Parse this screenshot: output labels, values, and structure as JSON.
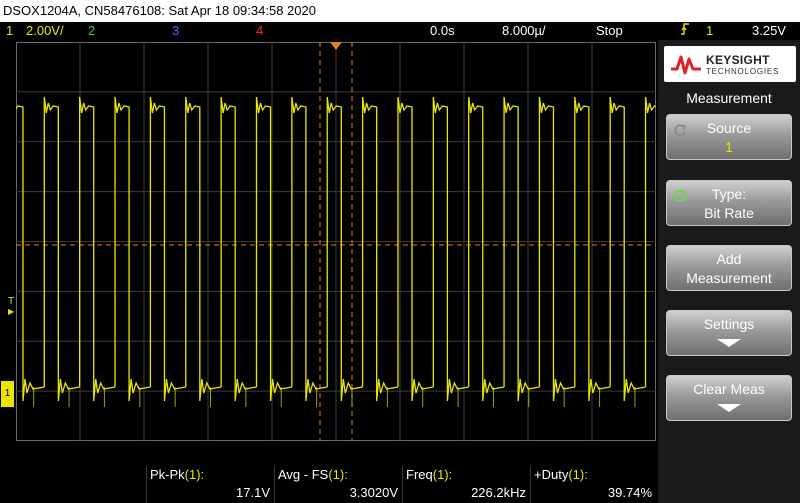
{
  "title_bar": {
    "text": "DSOX1204A, CN58476108: Sat Apr 18 09:34:58 2020"
  },
  "status": {
    "ch1_num": "1",
    "ch1_scale": "2.00V/",
    "ch2_num": "2",
    "ch3_num": "3",
    "ch4_num": "4",
    "time_delay": "0.0s",
    "time_scale": "8.000µ/",
    "run_state": "Stop",
    "trigger_icon": "rising-edge-icon",
    "trigger_source": "1",
    "trigger_level": "3.25V"
  },
  "colors": {
    "ch1": "#e8e600",
    "ch2": "#33cc33",
    "ch3": "#3f6fff",
    "ch4": "#ff2a2a",
    "cursor": "#e87d1c"
  },
  "logo": {
    "brand": "KEYSIGHT",
    "sub": "TECHNOLOGIES"
  },
  "menu": {
    "title": "Measurement",
    "keys": [
      {
        "line1": "Source",
        "line2": "1"
      },
      {
        "line1": "Type:",
        "line2": "Bit Rate"
      },
      {
        "line1": "Add",
        "line2": "Measurement"
      },
      {
        "line1": "Settings",
        "line2": ""
      },
      {
        "line1": "Clear Meas",
        "line2": ""
      }
    ]
  },
  "measurements": [
    {
      "label": "Pk-Pk",
      "channel": "(1):",
      "value": "17.1V"
    },
    {
      "label": "Avg - FS",
      "channel": "(1):",
      "value": "3.3020V"
    },
    {
      "label": "Freq",
      "channel": "(1):",
      "value": "226.2kHz"
    },
    {
      "label": "+Duty",
      "channel": "(1):",
      "value": "39.74%"
    }
  ],
  "markers": {
    "trigger_level": "T",
    "channel": "1"
  },
  "waveform": {
    "frequency_khz": 226.2,
    "duty_percent": 39.74,
    "peak_to_peak_v": 17.1,
    "volts_per_div": 2.0,
    "time_per_div_us": 8.0
  }
}
